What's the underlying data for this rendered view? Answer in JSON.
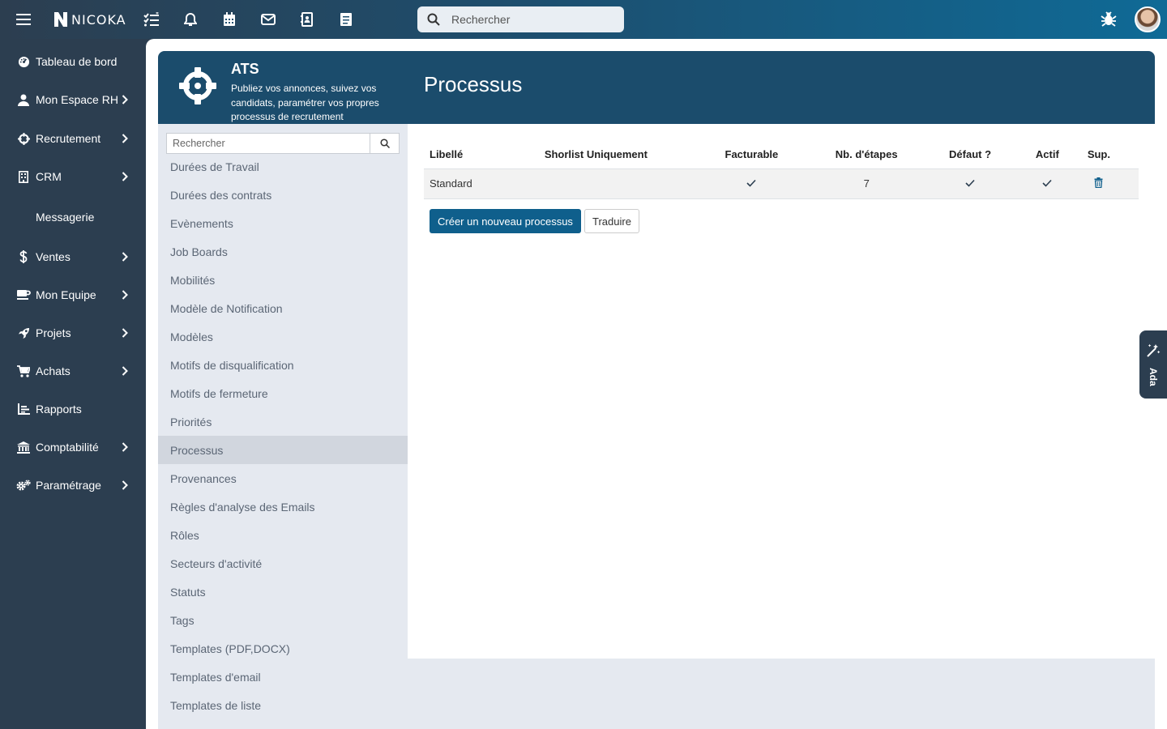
{
  "brand": {
    "logo_text": "NICOKA"
  },
  "search": {
    "placeholder": "Rechercher"
  },
  "sidebar": {
    "items": [
      {
        "label": "Tableau de bord",
        "icon": "dashboard-icon",
        "has_submenu": false
      },
      {
        "label": "Mon Espace RH",
        "icon": "user-icon",
        "has_submenu": true
      },
      {
        "label": "Recrutement",
        "icon": "crosshair-icon",
        "has_submenu": true
      },
      {
        "label": "CRM",
        "icon": "building-icon",
        "has_submenu": true
      },
      {
        "label": "Messagerie",
        "icon": "",
        "has_submenu": false
      },
      {
        "label": "Ventes",
        "icon": "dollar-icon",
        "has_submenu": true
      },
      {
        "label": "Mon Equipe",
        "icon": "coffee-icon",
        "has_submenu": true
      },
      {
        "label": "Projets",
        "icon": "rocket-icon",
        "has_submenu": true
      },
      {
        "label": "Achats",
        "icon": "cart-icon",
        "has_submenu": true
      },
      {
        "label": "Rapports",
        "icon": "chart-icon",
        "has_submenu": false
      },
      {
        "label": "Comptabilité",
        "icon": "bank-icon",
        "has_submenu": true
      },
      {
        "label": "Paramétrage",
        "icon": "cogs-icon",
        "has_submenu": true
      }
    ]
  },
  "module": {
    "title": "ATS",
    "description": "Publiez vos annonces, suivez vos candidats, paramétrer vos propres processus de recrutement"
  },
  "subnav": {
    "search_placeholder": "Rechercher",
    "items": [
      "Durées de Travail",
      "Durées des contrats",
      "Evènements",
      "Job Boards",
      "Mobilités",
      "Modèle de Notification",
      "Modèles",
      "Motifs de disqualification",
      "Motifs de fermeture",
      "Priorités",
      "Processus",
      "Provenances",
      "Règles d'analyse des Emails",
      "Rôles",
      "Secteurs d'activité",
      "Statuts",
      "Tags",
      "Templates (PDF,DOCX)",
      "Templates d'email",
      "Templates de liste"
    ],
    "active": "Processus"
  },
  "page": {
    "title": "Processus"
  },
  "table": {
    "columns": [
      "Libellé",
      "Shorlist Uniquement",
      "Facturable",
      "Nb. d'étapes",
      "Défaut ?",
      "Actif",
      "Sup."
    ],
    "rows": [
      {
        "libelle": "Standard",
        "shortlist": false,
        "facturable": true,
        "nb_etapes": "7",
        "defaut": true,
        "actif": true
      }
    ]
  },
  "actions": {
    "create_label": "Créer un nouveau processus",
    "translate_label": "Traduire"
  },
  "assistant": {
    "label": "Ada"
  },
  "colors": {
    "sidebar": "#2c3e50",
    "header": "#1b4c6c",
    "primary_button": "#0f5f8c",
    "subnav_bg": "#e5e9f0"
  }
}
